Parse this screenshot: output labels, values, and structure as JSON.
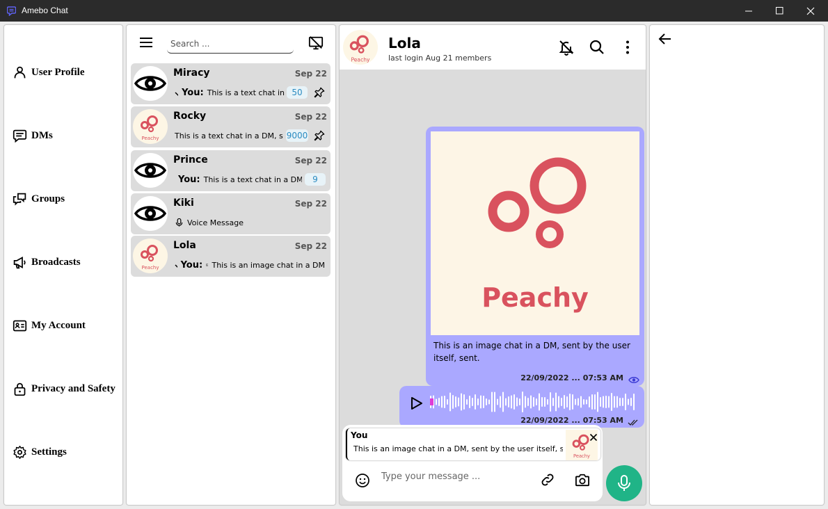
{
  "window": {
    "title": "Amebo Chat"
  },
  "nav": {
    "items": [
      {
        "label": "User Profile",
        "icon": "person-icon"
      },
      {
        "label": "DMs",
        "icon": "message-icon"
      },
      {
        "label": "Groups",
        "icon": "group-chat-icon"
      },
      {
        "label": "Broadcasts",
        "icon": "megaphone-icon"
      },
      {
        "label": "My Account",
        "icon": "id-card-icon"
      },
      {
        "label": "Privacy and Safety",
        "icon": "lock-icon"
      },
      {
        "label": "Settings",
        "icon": "gear-icon"
      }
    ]
  },
  "chat_list": {
    "search_placeholder": "Search ...",
    "items": [
      {
        "name": "Miracy",
        "date": "Sep 22",
        "avatar": "eye-icon",
        "status": "check-icon",
        "you": "You:",
        "preview": "This is a text chat in",
        "unread": "50",
        "pinned": true
      },
      {
        "name": "Rocky",
        "date": "Sep 22",
        "avatar": "peachy-logo",
        "preview": "This is a text chat in a DM, sent",
        "unread": "9000",
        "pinned": true
      },
      {
        "name": "Prince",
        "date": "Sep 22",
        "avatar": "eye-icon",
        "status": "clock-icon",
        "you": "You:",
        "preview": "This is a text chat in a DM",
        "unread": "9"
      },
      {
        "name": "Kiki",
        "date": "Sep 22",
        "avatar": "eye-icon",
        "status": "mic-icon",
        "preview": "Voice Message"
      },
      {
        "name": "Lola",
        "date": "Sep 22",
        "avatar": "peachy-logo",
        "status": "check-icon",
        "you": "You:",
        "preview_icon": "image-icon",
        "preview": "This is an image chat in a DM"
      }
    ]
  },
  "conversation": {
    "name": "Lola",
    "subtitle": "last login Aug 21 members",
    "logo_text": "Peachy",
    "messages": [
      {
        "type": "image",
        "image_text": "Peachy",
        "caption": "This is an image chat in a DM, sent by the user itself, sent.",
        "time": "22/09/2022 ... 07:53 AM",
        "status": "eye-icon"
      },
      {
        "type": "voice",
        "time": "22/09/2022 ... 07:53 AM",
        "status": "double-check-icon"
      }
    ],
    "reply": {
      "who": "You",
      "text": "This is an image chat in a DM, sent by the user itself, sent."
    },
    "input_placeholder": "Type your message ..."
  },
  "colors": {
    "accent_bubble": "#aaa8ff",
    "mic_button": "#20b487",
    "logo_red": "#d9525e",
    "logo_bg": "#fdf5e6",
    "badge_text": "#2a8bc1"
  }
}
